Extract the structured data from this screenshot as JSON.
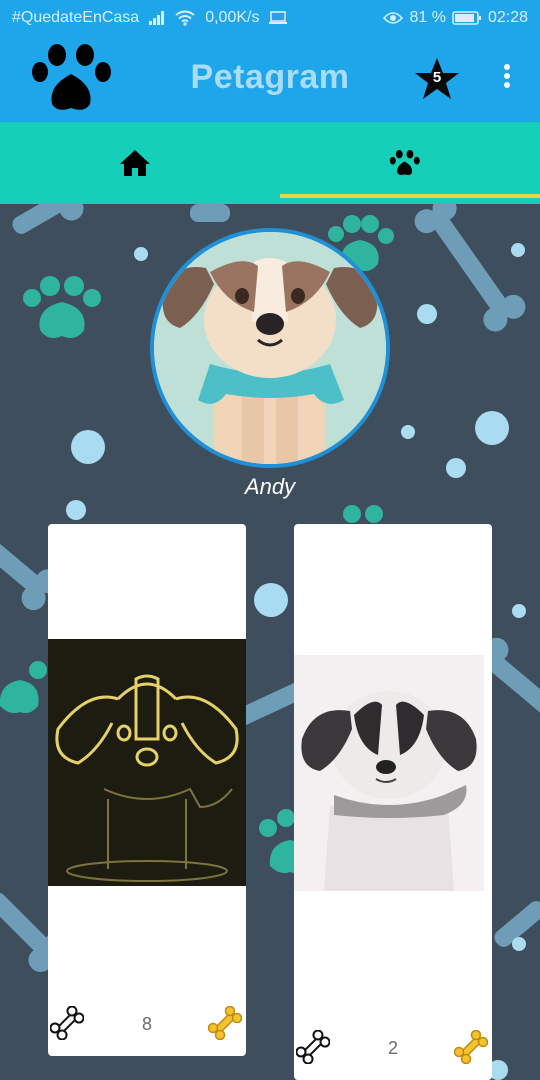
{
  "status_bar": {
    "carrier": "#QuedateEnCasa",
    "speed": "0,00K/s",
    "battery": "81 %",
    "time": "02:28"
  },
  "app_bar": {
    "title": "Petagram",
    "rating_count": "5",
    "logo_icon": "paw-icon",
    "star_icon": "star-icon",
    "menu_icon": "overflow-menu-icon"
  },
  "tabs": [
    {
      "icon": "home-icon",
      "selected": false
    },
    {
      "icon": "paw-icon",
      "selected": true
    }
  ],
  "profile": {
    "name": "Andy"
  },
  "pets": [
    {
      "likes": "8",
      "like_icon": "bone-icon",
      "rate_icon": "golden-bone-icon"
    },
    {
      "likes": "2",
      "like_icon": "bone-icon",
      "rate_icon": "golden-bone-icon"
    }
  ],
  "colors": {
    "primary": "#1fa6ea",
    "accent": "#16cfb9",
    "indicator": "#e6d84a",
    "background": "#3f4e5c"
  }
}
